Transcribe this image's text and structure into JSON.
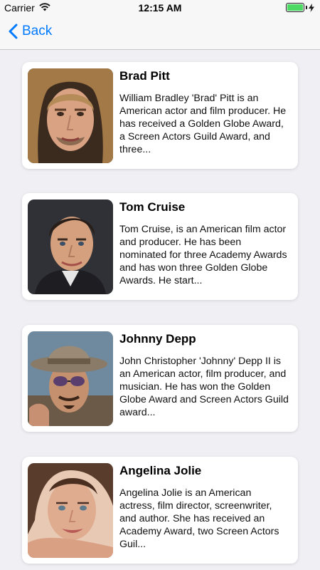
{
  "status": {
    "carrier": "Carrier",
    "time": "12:15 AM"
  },
  "nav": {
    "back_label": "Back",
    "accent_color": "#007aff"
  },
  "cards": [
    {
      "name": "Brad Pitt",
      "description": "William Bradley 'Brad' Pitt is an American actor and film producer. He has received a Golden Globe Award, a Screen Actors Guild Award, and three..."
    },
    {
      "name": "Tom Cruise",
      "description": "Tom Cruise, is an American film actor and producer. He has been nominated for three Academy Awards and has won three Golden Globe Awards. He start..."
    },
    {
      "name": "Johnny Depp",
      "description": "John Christopher 'Johnny' Depp II is an American actor, film producer, and musician. He has won the Golden Globe Award and Screen Actors Guild award..."
    },
    {
      "name": "Angelina Jolie",
      "description": "Angelina Jolie is an American actress, film director, screenwriter, and author. She has received an Academy Award, two Screen Actors Guil..."
    }
  ]
}
